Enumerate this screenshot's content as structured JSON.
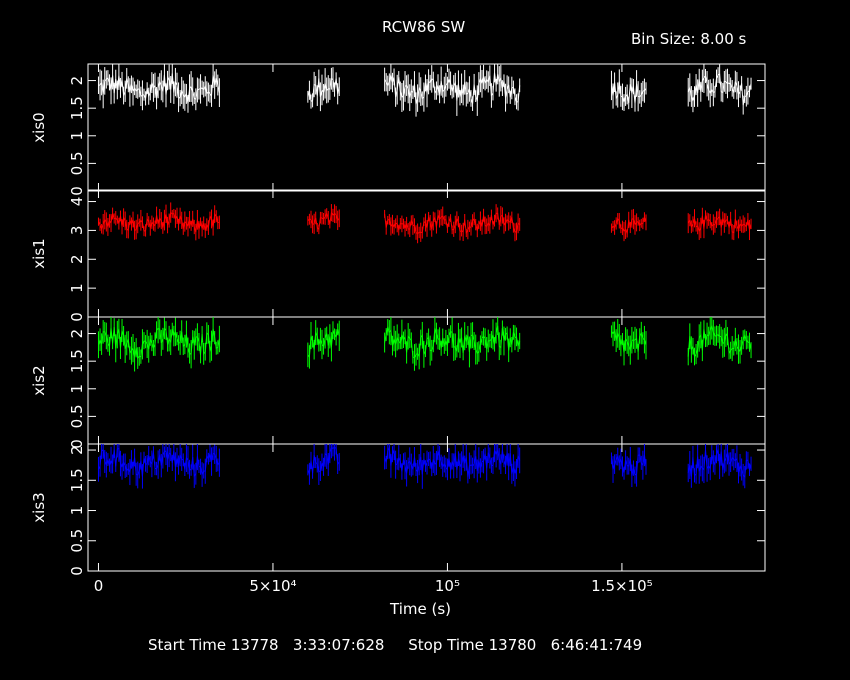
{
  "header": {
    "title": "RCW86 SW",
    "bin_size": "Bin Size: 8.00 s"
  },
  "footer": {
    "text": "Start Time 13778   3:33:07:628     Stop Time 13780   6:46:41:749"
  },
  "colors": {
    "xis0": "#ffffff",
    "xis1": "#ff0000",
    "xis2": "#00ff00",
    "xis3": "#0000ff",
    "frame": "#ffffff",
    "background": "#000000"
  },
  "chart_data": {
    "type": "line",
    "title": "RCW86 SW",
    "subtitle": "Bin Size: 8.00 s",
    "xlabel": "Time (s)",
    "xlim": [
      -3000,
      191000
    ],
    "x_ticks": [
      {
        "value": 0,
        "label": "0"
      },
      {
        "value": 50000,
        "label": "5×10⁴"
      },
      {
        "value": 100000,
        "label": "10⁵"
      },
      {
        "value": 150000,
        "label": "1.5×10⁵"
      }
    ],
    "observation_segments": [
      [
        0,
        35000
      ],
      [
        60000,
        69000
      ],
      [
        82000,
        121000
      ],
      [
        147000,
        157000
      ],
      [
        169000,
        187000
      ]
    ],
    "panels": [
      {
        "name": "xis0",
        "ylabel": "xis0",
        "ylim": [
          0,
          2.3
        ],
        "yticks": [
          "0",
          "0.5",
          "1",
          "1.5",
          "2"
        ],
        "ytick_values": [
          0,
          0.5,
          1,
          1.5,
          2
        ],
        "mean_rate": 1.85,
        "scatter": 0.35,
        "color": "#ffffff"
      },
      {
        "name": "xis1",
        "ylabel": "xis1",
        "ylim": [
          0,
          4.4
        ],
        "yticks": [
          "0",
          "1",
          "2",
          "3",
          "4"
        ],
        "ytick_values": [
          0,
          1,
          2,
          3,
          4
        ],
        "mean_rate": 3.25,
        "scatter": 0.45,
        "color": "#ff0000"
      },
      {
        "name": "xis2",
        "ylabel": "xis2",
        "ylim": [
          0,
          2.3
        ],
        "yticks": [
          "0",
          "0.5",
          "1",
          "1.5",
          "2"
        ],
        "ytick_values": [
          0,
          0.5,
          1,
          1.5,
          2
        ],
        "mean_rate": 1.85,
        "scatter": 0.35,
        "color": "#00ff00"
      },
      {
        "name": "xis3",
        "ylabel": "xis3",
        "ylim": [
          0,
          2.1
        ],
        "yticks": [
          "0",
          "0.5",
          "1",
          "1.5",
          "2"
        ],
        "ytick_values": [
          0,
          0.5,
          1,
          1.5,
          2
        ],
        "mean_rate": 1.8,
        "scatter": 0.3,
        "color": "#0000ff"
      }
    ]
  }
}
